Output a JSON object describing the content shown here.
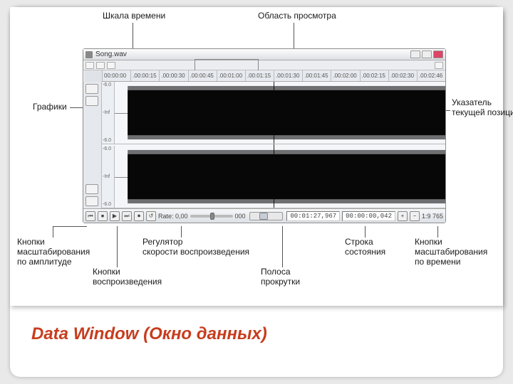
{
  "caption": "Data Window (Окно данных)",
  "labels": {
    "timeline": "Шкала времени",
    "viewport": "Область просмотра",
    "graphs": "Графики",
    "posindicator": "Указатель\nтекущей позиции",
    "ampbuttons": "Кнопки\nмасштабирования\nпо амплитуде",
    "playbuttons": "Кнопки\nвоспроизведения",
    "rateslider": "Регулятор\nскорости воспроизведения",
    "scrollbar": "Полоса\nпрокрутки",
    "statusline": "Строка\nсостояния",
    "timebuttons": "Кнопки\nмасштабирования\nпо времени"
  },
  "app": {
    "title": "Song.wav",
    "ruler": [
      "00:00:00",
      ".00:00:15",
      ".00:00:30",
      ".00:00:45",
      ".00:01:00",
      ".00:01:15",
      ".00:01:30",
      ".00:01:45",
      ".00:02:00",
      ".00:02:15",
      ".00:02:30",
      ".00:02:46"
    ],
    "axis_ticks": [
      "-6.0",
      "-Inf",
      "-6.0"
    ],
    "status": {
      "rate_label": "Rate: 0,00",
      "rate_mid": "000",
      "position": "00:01:27,967",
      "selection": "00:00:00,042",
      "zoom": "1:9 765"
    },
    "playicons": [
      "⏮",
      "⏹",
      "▶",
      "⏭",
      "⏺",
      "↺"
    ]
  }
}
